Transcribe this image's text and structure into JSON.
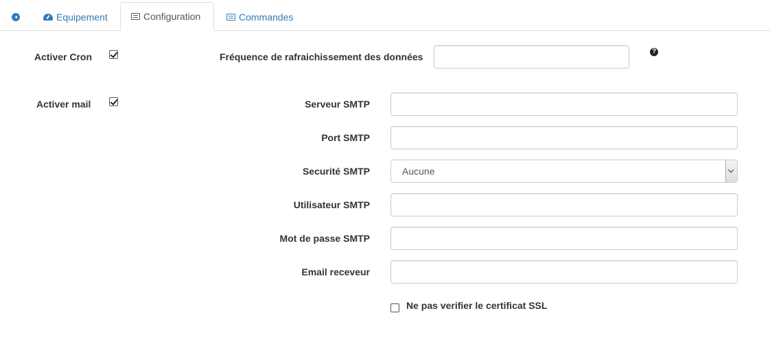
{
  "tabs": {
    "equipement": "Equipement",
    "configuration": "Configuration",
    "commandes": "Commandes"
  },
  "form": {
    "cron_label": "Activer Cron",
    "cron_checked": true,
    "frequency_label": "Fréquence de rafraichissement des données",
    "frequency_value": "",
    "help_glyph": "?",
    "mail_label": "Activer mail",
    "mail_checked": true,
    "smtp_server_label": "Serveur SMTP",
    "smtp_server_value": "",
    "smtp_port_label": "Port SMTP",
    "smtp_port_value": "",
    "smtp_security_label": "Securité SMTP",
    "smtp_security_selected": "Aucune",
    "smtp_user_label": "Utilisateur SMTP",
    "smtp_user_value": "",
    "smtp_password_label": "Mot de passe SMTP",
    "smtp_password_value": "",
    "email_receiver_label": "Email receveur",
    "email_receiver_value": "",
    "ssl_label": "Ne pas verifier le certificat SSL",
    "ssl_checked": false
  },
  "icons": {
    "back": "arrow-circle-left-icon",
    "equipement": "tachometer-icon",
    "configuration": "list-alt-icon",
    "commandes": "list-alt-icon",
    "help": "question-circle-icon"
  },
  "colors": {
    "link": "#337ab7",
    "active_tab_text": "#555555",
    "border": "#dddddd"
  }
}
